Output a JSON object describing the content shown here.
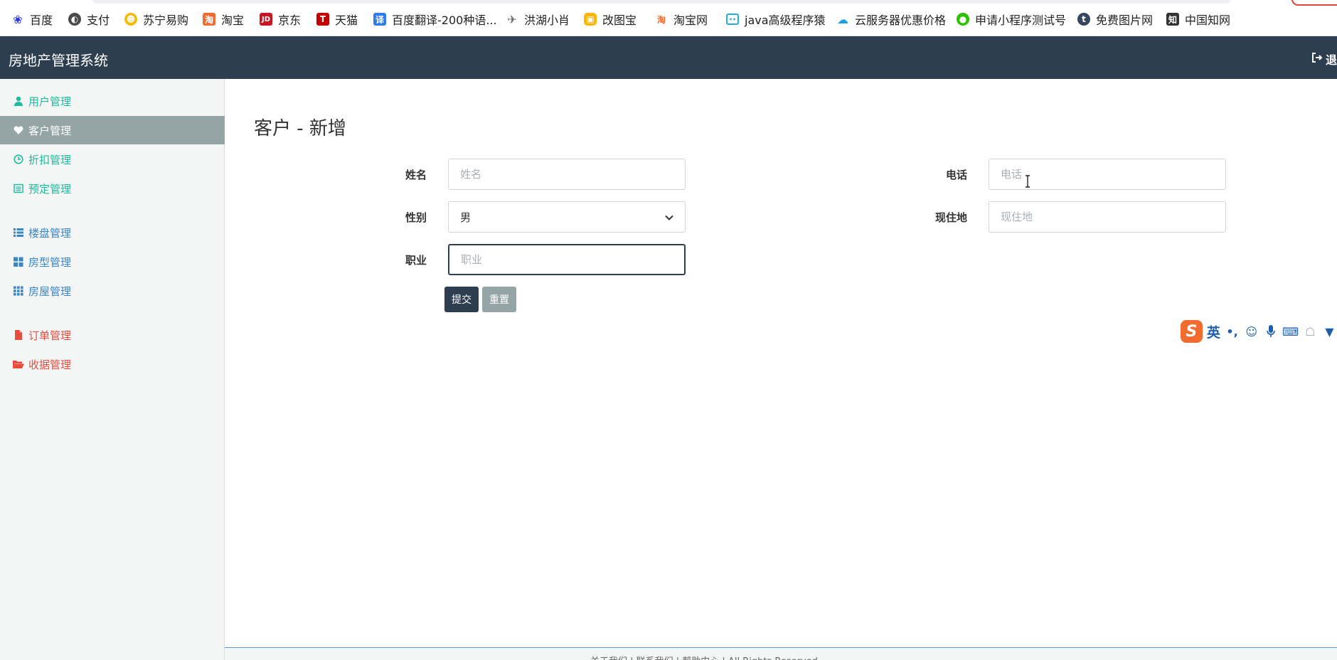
{
  "bookmarks": [
    {
      "label": "百度",
      "icon": "baidu-paw-icon",
      "color": "#2932e1"
    },
    {
      "label": "支付",
      "icon": "globe-icon",
      "color": "#4a4a4a"
    },
    {
      "label": "苏宁易购",
      "icon": "suning-lion-icon",
      "color": "#f5b90a"
    },
    {
      "label": "淘宝",
      "icon": "taobao-icon",
      "color": "#f26b2f"
    },
    {
      "label": "京东",
      "icon": "jd-icon",
      "color": "#c91623"
    },
    {
      "label": "天猫",
      "icon": "tmall-icon",
      "color": "#c40000"
    },
    {
      "label": "百度翻译-200种语...",
      "icon": "translate-icon",
      "color": "#2f7bea"
    },
    {
      "label": "洪湖小肖",
      "icon": "bird-icon",
      "color": "#6b6b6b"
    },
    {
      "label": "改图宝",
      "icon": "gaitubao-icon",
      "color": "#ffb400"
    },
    {
      "label": "淘宝网",
      "icon": "taobao-icon",
      "color": "#f26b2f"
    },
    {
      "label": "java高级程序猿",
      "icon": "bilibili-icon",
      "color": "#23ade5"
    },
    {
      "label": "云服务器优惠价格",
      "icon": "cloud-icon",
      "color": "#1aa0e8"
    },
    {
      "label": "申请小程序测试号",
      "icon": "wechat-icon",
      "color": "#2dc100"
    },
    {
      "label": "免费图片网",
      "icon": "tumblr-icon",
      "color": "#36465d"
    },
    {
      "label": "中国知网",
      "icon": "cnki-icon",
      "color": "#333333"
    }
  ],
  "header": {
    "brand": "房地产管理系统",
    "logout_label": "退",
    "bg_color": "#2d3e50"
  },
  "sidebar": {
    "items": [
      {
        "label": "用户管理",
        "icon": "user-icon",
        "tone": "green",
        "active": false
      },
      {
        "label": "客户管理",
        "icon": "heart-icon",
        "tone": "green",
        "active": true
      },
      {
        "label": "折扣管理",
        "icon": "clock-icon",
        "tone": "green",
        "active": false
      },
      {
        "label": "预定管理",
        "icon": "list-alt-icon",
        "tone": "green",
        "active": false
      },
      {
        "label": "楼盘管理",
        "icon": "list-icon",
        "tone": "blue",
        "active": false
      },
      {
        "label": "房型管理",
        "icon": "th-large-icon",
        "tone": "blue",
        "active": false
      },
      {
        "label": "房屋管理",
        "icon": "th-icon",
        "tone": "blue",
        "active": false
      },
      {
        "label": "订单管理",
        "icon": "file-icon",
        "tone": "red",
        "active": false
      },
      {
        "label": "收据管理",
        "icon": "folder-open-icon",
        "tone": "red",
        "active": false
      }
    ]
  },
  "main": {
    "title": "客户 - 新增",
    "form": {
      "name_label": "姓名",
      "name_placeholder": "姓名",
      "phone_label": "电话",
      "phone_placeholder": "电话",
      "gender_label": "性别",
      "gender_value": "男",
      "address_label": "现住地",
      "address_placeholder": "现住地",
      "job_label": "职业",
      "job_placeholder": "职业",
      "submit_label": "提交",
      "reset_label": "重置"
    }
  },
  "ime": {
    "mode_label": "英",
    "punct_label": "•,"
  },
  "footer": {
    "text": "关于我们 | 联系我们 | 帮助中心 | All Rights Reserved"
  }
}
